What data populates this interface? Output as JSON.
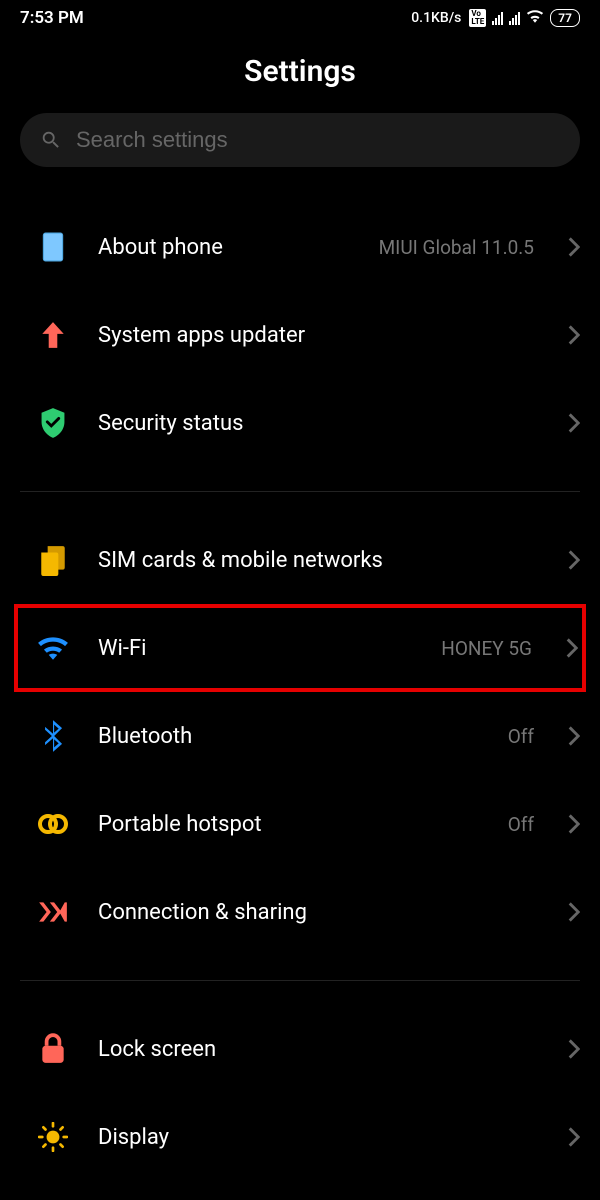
{
  "statusbar": {
    "time": "7:53 PM",
    "speed": "0.1KB/s",
    "battery": "77"
  },
  "header": {
    "title": "Settings"
  },
  "search": {
    "placeholder": "Search settings"
  },
  "rows": {
    "about_phone": {
      "label": "About phone",
      "value": "MIUI Global 11.0.5"
    },
    "system_updater": {
      "label": "System apps updater"
    },
    "security_status": {
      "label": "Security status"
    },
    "sim": {
      "label": "SIM cards & mobile networks"
    },
    "wifi": {
      "label": "Wi-Fi",
      "value": "HONEY 5G"
    },
    "bluetooth": {
      "label": "Bluetooth",
      "value": "Off"
    },
    "hotspot": {
      "label": "Portable hotspot",
      "value": "Off"
    },
    "connection": {
      "label": "Connection & sharing"
    },
    "lock": {
      "label": "Lock screen"
    },
    "display": {
      "label": "Display"
    }
  },
  "colors": {
    "highlight": "#e60000",
    "accent_blue": "#1e90ff",
    "accent_green": "#2ecc71",
    "accent_coral": "#ff6659",
    "accent_amber": "#f5b800"
  }
}
